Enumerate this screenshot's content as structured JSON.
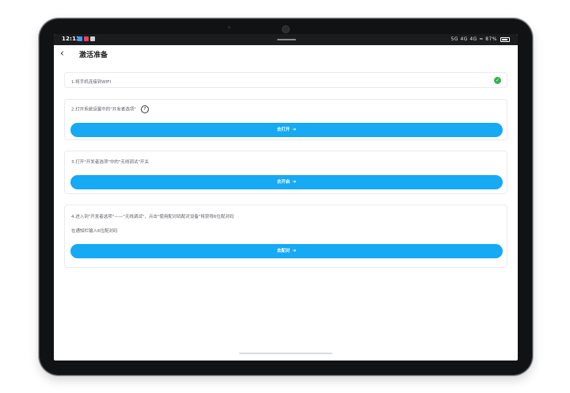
{
  "status_bar": {
    "time": "12:13",
    "notification_icons": [
      "#3d9bff",
      "#ff3b5c",
      "#cfd3d8"
    ],
    "right_status": "5G 4G 4G ≈ 87%"
  },
  "header": {
    "back_icon": "‹",
    "title": "激活准备"
  },
  "steps": [
    {
      "text": "1.将手机连接到WIFI",
      "check_icon": "✓"
    },
    {
      "text": "2.打开系统设置中的\"开发者选项\"",
      "help_icon": "?",
      "button_label": "去打开",
      "arrow": "➔"
    },
    {
      "text": "3.打开\"开发者选项\"中的\"无线调试\"开关",
      "button_label": "去开启",
      "arrow": "➔"
    },
    {
      "text": "4.进入到\"开发者选项\"——\"无线调试\"，点击\"使用配对码配对设备\"将获得6位配对码",
      "subtext": "在通知栏输入6位配对码",
      "button_label": "去配对",
      "arrow": "➔"
    }
  ],
  "colors": {
    "accent": "#16a9f4",
    "success": "#2fb44a"
  }
}
